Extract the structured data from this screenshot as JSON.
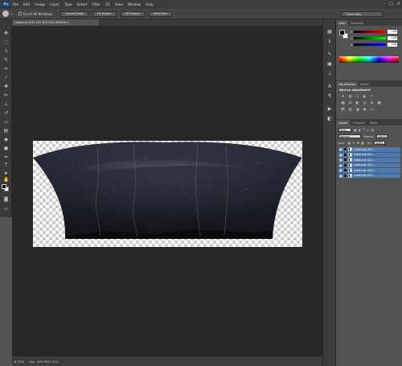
{
  "app": {
    "logo": "Ps"
  },
  "menu": [
    "File",
    "Edit",
    "Image",
    "Layer",
    "Type",
    "Select",
    "Filter",
    "3D",
    "View",
    "Window",
    "Help"
  ],
  "window_controls": [
    "–",
    "□",
    "×"
  ],
  "options_bar": {
    "scroll_all_label": "Scroll All Windows",
    "buttons": [
      "Actual Pixels",
      "Fit Screen",
      "Fill Screen",
      "Print Size"
    ],
    "workspace": "Essentials"
  },
  "document": {
    "tab_title": "Lakehurst-9/11.CR2 @ 8.33% (RGB/8*) *",
    "zoom": "8.33%",
    "doc_info": "Doc: 295.3M/1.23G"
  },
  "color_panel": {
    "tabs": [
      "Color",
      "Swatches"
    ],
    "channels": [
      {
        "name": "R",
        "value": "128"
      },
      {
        "name": "G",
        "value": "128"
      },
      {
        "name": "B",
        "value": "128"
      }
    ]
  },
  "adjustments_panel": {
    "tabs": [
      "Adjustments",
      "Styles"
    ],
    "title": "Add an adjustment"
  },
  "layers_panel": {
    "tabs": [
      "Layers",
      "Channels",
      "Paths"
    ],
    "filter_label": "Kind",
    "blend_mode": "Normal",
    "opacity_label": "Opacity:",
    "opacity_value": "100%",
    "lock_label": "Lock:",
    "fill_label": "Fill:",
    "fill_value": "100%",
    "layers": [
      {
        "name": "Lakehurst-010..."
      },
      {
        "name": "Lakehurst-011..."
      },
      {
        "name": "Lakehurst-012..."
      },
      {
        "name": "Lakehurst-013..."
      },
      {
        "name": "Lakehurst-014..."
      },
      {
        "name": "Lakehurst-015..."
      }
    ]
  },
  "colors": {
    "accent_selection": "#4f79a8",
    "canvas_bg": "#282828",
    "ui_bg": "#535353"
  }
}
